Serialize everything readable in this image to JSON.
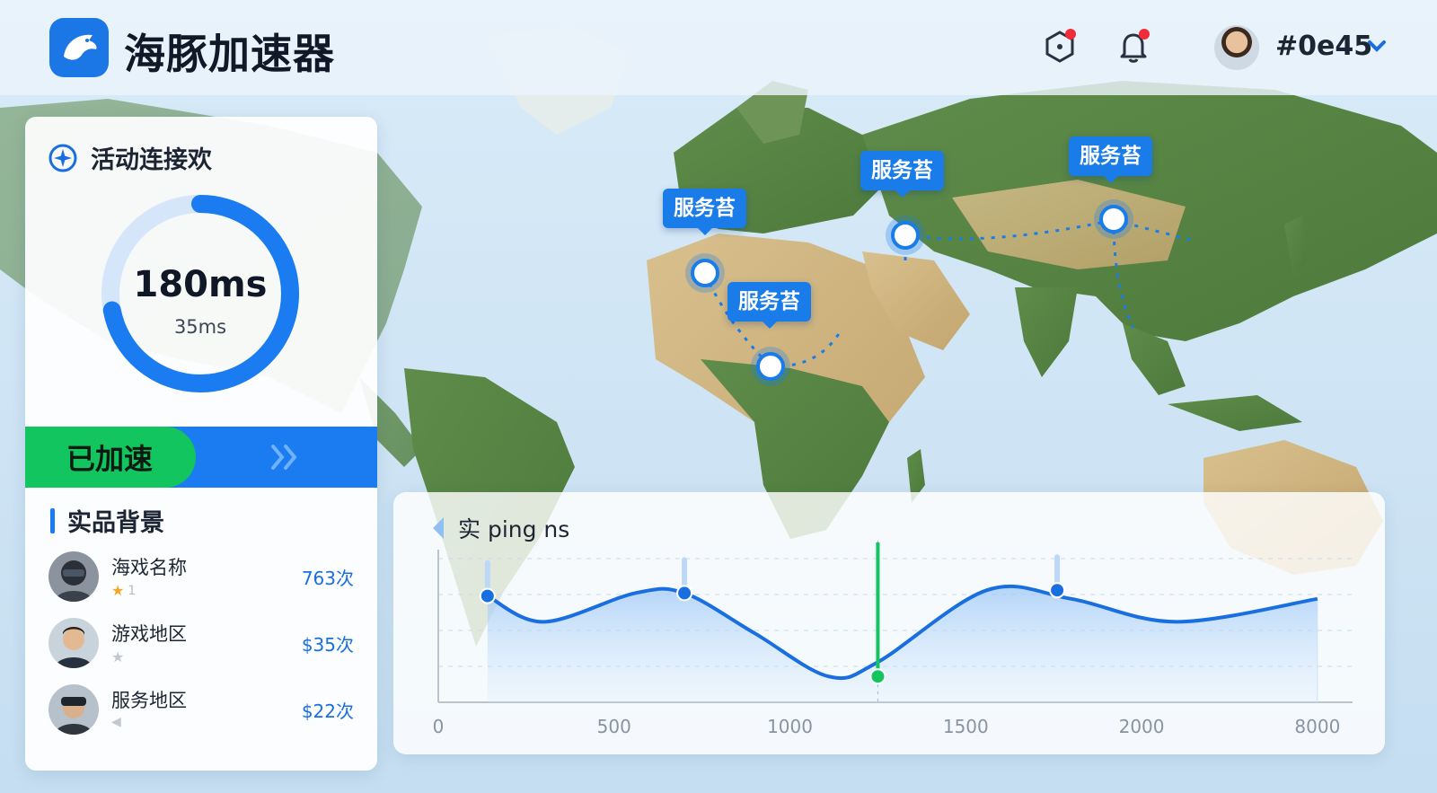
{
  "app": {
    "title": "海豚加速器"
  },
  "header": {
    "user_name": "#0e45",
    "icons": [
      "settings-hex-icon",
      "notification-bell-icon",
      "chevron-down-icon"
    ],
    "badge_color": "#ef2d3a"
  },
  "connection": {
    "heading": "活动连接欢",
    "latency": "180ms",
    "sub_latency": "35ms",
    "gauge_progress": 0.72,
    "accelerate_label": "已加速"
  },
  "games": {
    "heading": "实品背景",
    "items": [
      {
        "name": "海戏名称",
        "count": "763次",
        "rating": "1"
      },
      {
        "name": "游戏地区",
        "count": "$35次",
        "rating": ""
      },
      {
        "name": "服务地区",
        "count": "$22次",
        "rating": ""
      }
    ]
  },
  "map": {
    "servers": [
      {
        "label": "服务苔"
      },
      {
        "label": "服务苔"
      },
      {
        "label": "服务苔"
      },
      {
        "label": "服务苔"
      }
    ]
  },
  "ping_chart": {
    "title": "实 ping ns"
  },
  "chart_data": {
    "type": "line",
    "title": "实 ping ns",
    "x_tick_labels": [
      "0",
      "500",
      "1000",
      "1500",
      "2000",
      "8000"
    ],
    "x_ticks": [
      0,
      500,
      1000,
      1500,
      2000,
      2500
    ],
    "series": [
      {
        "x": [
          140,
          300,
          560,
          700,
          900,
          1110,
          1250,
          1560,
          1800,
          2100,
          2500
        ],
        "values": [
          0.74,
          0.56,
          0.76,
          0.76,
          0.48,
          0.18,
          0.28,
          0.78,
          0.72,
          0.56,
          0.72
        ]
      }
    ],
    "markers": [
      {
        "x": 140,
        "y": 0.74,
        "color": "#1a6fe0"
      },
      {
        "x": 700,
        "y": 0.76,
        "color": "#1a6fe0"
      },
      {
        "x": 1250,
        "y": 0.18,
        "color": "#12c55e"
      },
      {
        "x": 1760,
        "y": 0.78,
        "color": "#1a6fe0"
      }
    ],
    "highlight_x": 1250,
    "xlim": [
      0,
      2600
    ],
    "ylim": [
      0,
      1
    ],
    "grid": true,
    "colors": {
      "line": "#1a6fe0",
      "highlight": "#12c55e"
    }
  }
}
